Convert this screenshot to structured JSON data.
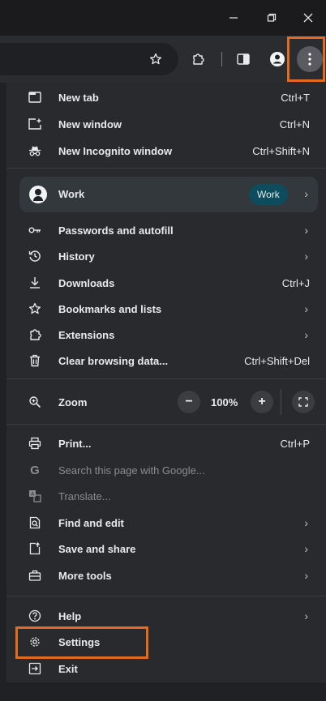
{
  "window_controls": {
    "minimize_icon": "minimize-icon",
    "restore_icon": "restore-icon",
    "close_icon": "close-icon"
  },
  "toolbar": {
    "bookmark_icon": "star-icon",
    "extensions_icon": "puzzle-icon",
    "sidepanel_icon": "side-panel-icon",
    "profile_icon": "profile-icon",
    "menu_icon": "three-dots-icon"
  },
  "menu": {
    "new_tab": {
      "label": "New tab",
      "shortcut": "Ctrl+T"
    },
    "new_window": {
      "label": "New window",
      "shortcut": "Ctrl+N"
    },
    "new_incognito": {
      "label": "New Incognito window",
      "shortcut": "Ctrl+Shift+N"
    },
    "profile": {
      "name": "Work",
      "badge": "Work"
    },
    "passwords": {
      "label": "Passwords and autofill"
    },
    "history": {
      "label": "History"
    },
    "downloads": {
      "label": "Downloads",
      "shortcut": "Ctrl+J"
    },
    "bookmarks": {
      "label": "Bookmarks and lists"
    },
    "extensions": {
      "label": "Extensions"
    },
    "clear_data": {
      "label": "Clear browsing data...",
      "shortcut": "Ctrl+Shift+Del"
    },
    "zoom": {
      "label": "Zoom",
      "minus": "−",
      "value": "100%",
      "plus": "+"
    },
    "print": {
      "label": "Print...",
      "shortcut": "Ctrl+P"
    },
    "search_google": {
      "label": "Search this page with Google..."
    },
    "translate": {
      "label": "Translate..."
    },
    "find_edit": {
      "label": "Find and edit"
    },
    "save_share": {
      "label": "Save and share"
    },
    "more_tools": {
      "label": "More tools"
    },
    "help": {
      "label": "Help"
    },
    "settings": {
      "label": "Settings"
    },
    "exit": {
      "label": "Exit"
    }
  },
  "colors": {
    "highlight": "#e36a1f",
    "menu_bg": "#292a2d",
    "badge_bg": "#0c4c5c"
  }
}
